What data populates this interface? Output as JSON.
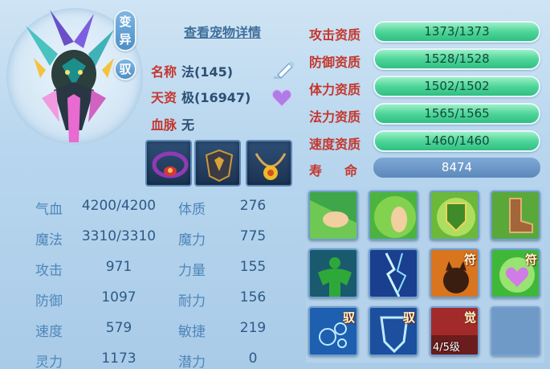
{
  "header": {
    "detail_link": "查看宠物详情",
    "badge_variant": "变异",
    "badge_ride": "驭"
  },
  "info": {
    "name_label": "名称",
    "name_value": "法(145)",
    "zizhi_label": "天资",
    "zizhi_value": "极(16947)",
    "xuemai_label": "血脉",
    "xuemai_value": "无"
  },
  "stats": {
    "rows": [
      {
        "k1": "气血",
        "v1": "4200/4200",
        "k2": "体质",
        "v2": "276"
      },
      {
        "k1": "魔法",
        "v1": "3310/3310",
        "k2": "魔力",
        "v2": "775"
      },
      {
        "k1": "攻击",
        "v1": "971",
        "k2": "力量",
        "v2": "155"
      },
      {
        "k1": "防御",
        "v1": "1097",
        "k2": "耐力",
        "v2": "156"
      },
      {
        "k1": "速度",
        "v1": "579",
        "k2": "敏捷",
        "v2": "219"
      },
      {
        "k1": "灵力",
        "v1": "1173",
        "k2": "潜力",
        "v2": "0"
      }
    ]
  },
  "aptitude": [
    {
      "label": "攻击资质",
      "value": "1373/1373",
      "fraction": 1.0
    },
    {
      "label": "防御资质",
      "value": "1528/1528",
      "fraction": 1.0
    },
    {
      "label": "体力资质",
      "value": "1502/1502",
      "fraction": 1.0
    },
    {
      "label": "法力资质",
      "value": "1565/1565",
      "fraction": 1.0
    },
    {
      "label": "速度资质",
      "value": "1460/1460",
      "fraction": 1.0
    }
  ],
  "life": {
    "label": "寿命",
    "value": "8474"
  },
  "skills": {
    "tag_fu": "符",
    "tag_yu": "驭",
    "tag_jue": "觉",
    "level": "4/5级"
  },
  "colors": {
    "accent_red": "#c4372e",
    "bar_green": "#4ed59a",
    "life_blue": "#5c89bc"
  }
}
